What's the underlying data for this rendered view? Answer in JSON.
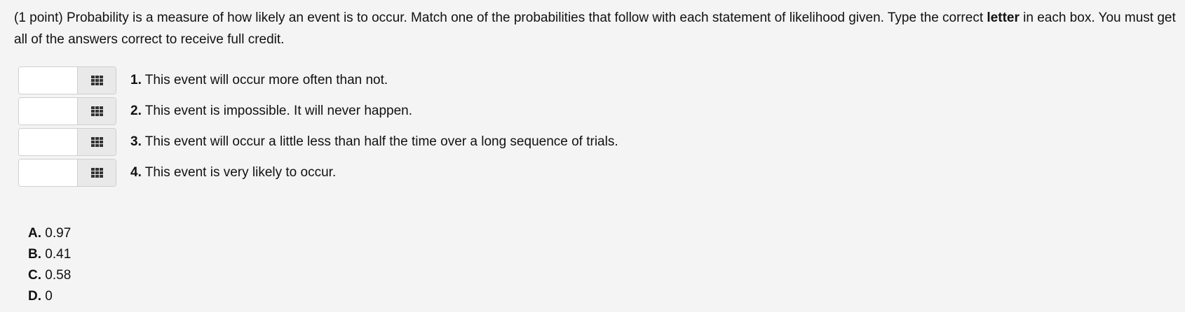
{
  "problem": {
    "intro_before_bold": "(1 point) Probability is a measure of how likely an event is to occur. Match one of the probabilities that follow with each statement of likelihood given. Type the correct ",
    "bold_word": "letter",
    "intro_after_bold": " in each box. You must get all of the answers correct to receive full credit."
  },
  "statements": [
    {
      "number": "1.",
      "text": " This event will occur more often than not.",
      "answer_value": ""
    },
    {
      "number": "2.",
      "text": " This event is impossible. It will never happen.",
      "answer_value": ""
    },
    {
      "number": "3.",
      "text": " This event will occur a little less than half the time over a long sequence of trials.",
      "answer_value": ""
    },
    {
      "number": "4.",
      "text": " This event is very likely to occur.",
      "answer_value": ""
    }
  ],
  "options": [
    {
      "letter": "A.",
      "value": " 0.97"
    },
    {
      "letter": "B.",
      "value": " 0.41"
    },
    {
      "letter": "C.",
      "value": " 0.58"
    },
    {
      "letter": "D.",
      "value": " 0"
    }
  ],
  "icons": {
    "grid_button": "grid-icon"
  }
}
